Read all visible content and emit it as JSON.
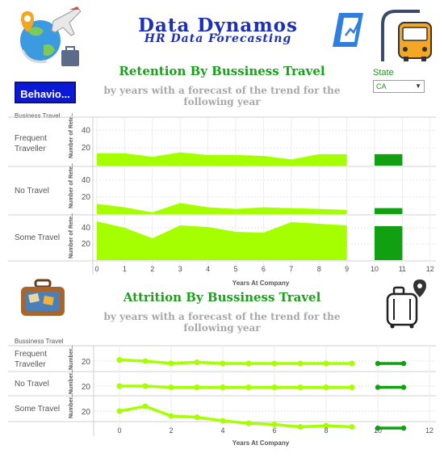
{
  "header": {
    "brand_line1": "Data Dynamos",
    "brand_line2": "HR Data Forecasting"
  },
  "retention": {
    "title": "Retention By Bussiness Travel",
    "subtitle": "by years with a forecast of the trend for the following year",
    "row_header": "Business Travel",
    "y_axis_title": "Number of Rete..",
    "x_axis_title": "Years At Company",
    "rows": [
      "Frequent Traveller",
      "No Travel",
      "Some Travel"
    ]
  },
  "attrition": {
    "title": "Attrition By Bussiness Travel",
    "subtitle": "by years with a forecast of the trend for the following year",
    "row_header": "Bussiness Travel",
    "y_axis_title": "Number..",
    "x_axis_title": "Years At Company",
    "rows": [
      "Frequent Traveller",
      "No Travel",
      "Some Travel"
    ]
  },
  "controls": {
    "behavior_button": "Behavio...",
    "state_label": "State",
    "state_value": "CA"
  },
  "colors": {
    "actual": "#a6ff00",
    "forecast": "#11a011",
    "title_green": "#1aa01a",
    "brand_blue": "#1b2fb8",
    "button_blue": "#0b1ad6"
  },
  "chart_data": [
    {
      "type": "area",
      "title": "Retention By Bussiness Travel",
      "xlabel": "Years At Company",
      "ylabel": "Number of Rete..",
      "x_ticks": [
        0,
        1,
        2,
        3,
        4,
        5,
        6,
        7,
        8,
        9,
        10,
        11,
        12
      ],
      "y_ticks": [
        20,
        40
      ],
      "ylim": [
        0,
        55
      ],
      "x": [
        0,
        1,
        2,
        3,
        4,
        5,
        6,
        7,
        8,
        9
      ],
      "series": [
        {
          "name": "Frequent Traveller",
          "values": [
            14,
            14,
            10,
            15,
            12,
            12,
            11,
            7,
            13,
            13
          ],
          "forecast": {
            "x": [
              10,
              11
            ],
            "values": [
              13,
              13
            ]
          }
        },
        {
          "name": "No Travel",
          "values": [
            12,
            8,
            2,
            13,
            8,
            6,
            8,
            7,
            6,
            5
          ],
          "forecast": {
            "x": [
              10,
              11
            ],
            "values": [
              7,
              7
            ]
          }
        },
        {
          "name": "Some Travel",
          "values": [
            48,
            40,
            27,
            43,
            41,
            35,
            34,
            47,
            45,
            43
          ],
          "forecast": {
            "x": [
              10,
              11
            ],
            "values": [
              42,
              42
            ]
          }
        }
      ]
    },
    {
      "type": "line",
      "title": "Attrition By Bussiness Travel",
      "xlabel": "Years At Company",
      "ylabel": "Number..",
      "x_ticks": [
        0,
        2,
        4,
        6,
        8,
        10,
        12
      ],
      "y_ticks": [
        20
      ],
      "x": [
        0,
        1,
        2,
        3,
        4,
        5,
        6,
        7,
        8,
        9
      ],
      "series": [
        {
          "name": "Frequent Traveller",
          "values": [
            21,
            20,
            18,
            19,
            18,
            18,
            18,
            18,
            18,
            18
          ],
          "forecast": {
            "x": [
              10,
              11
            ],
            "values": [
              18,
              18
            ]
          }
        },
        {
          "name": "No Travel",
          "values": [
            20,
            20,
            19,
            19,
            19,
            19,
            19,
            19,
            19,
            19
          ],
          "forecast": {
            "x": [
              10,
              11
            ],
            "values": [
              19,
              19
            ]
          }
        },
        {
          "name": "Some Travel",
          "values": [
            20,
            24,
            16,
            15,
            12,
            10,
            9,
            7,
            8,
            7
          ],
          "forecast": {
            "x": [
              10,
              11
            ],
            "values": [
              6,
              6
            ]
          }
        }
      ]
    }
  ]
}
